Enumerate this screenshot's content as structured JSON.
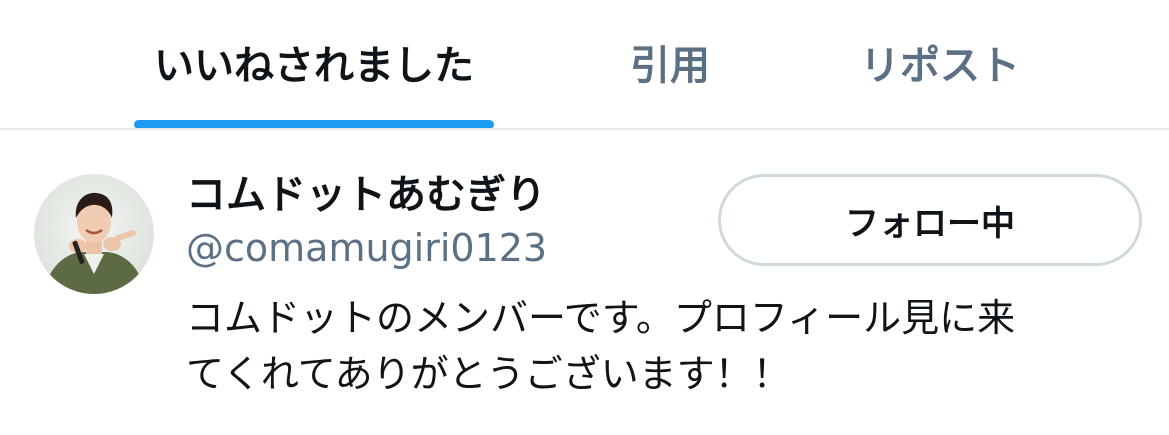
{
  "tabs": [
    {
      "label": "いいねされました",
      "active": true
    },
    {
      "label": "引用",
      "active": false
    },
    {
      "label": "リポスト",
      "active": false
    }
  ],
  "colors": {
    "accent": "#1d9bf0",
    "primary_text": "#0f1419",
    "secondary_text": "#5b7083",
    "divider": "#e6ecf0",
    "button_border": "#cfd9de"
  },
  "user": {
    "display_name": "コムドットあむぎり",
    "handle": "@comamugiri0123",
    "bio_line1": "コムドットのメンバーです。プロフィール見に来",
    "bio_line2": "てくれてありがとうございます！！",
    "follow_button_label": "フォロー中",
    "avatar_icon": "user-avatar-photo"
  }
}
